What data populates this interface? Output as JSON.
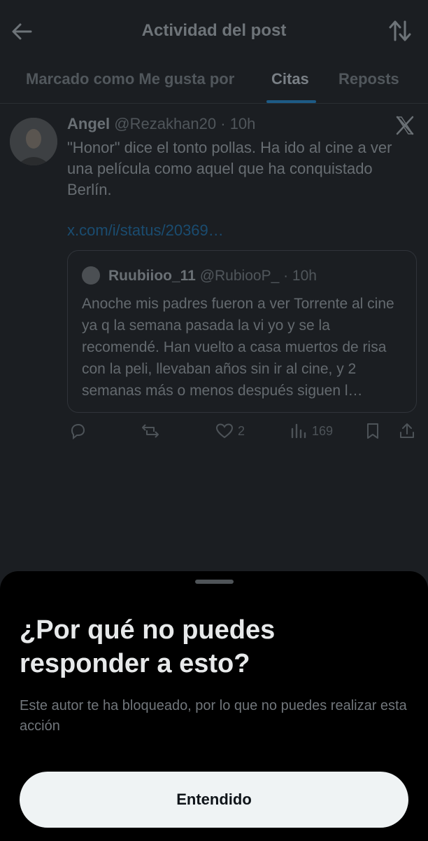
{
  "header": {
    "title": "Actividad del post",
    "back_icon": "arrow-left-icon",
    "sort_icon": "sort-arrows-icon"
  },
  "tabs": [
    {
      "label": "Marcado como Me gusta por",
      "active": false
    },
    {
      "label": "Citas",
      "active": true
    },
    {
      "label": "Reposts",
      "active": false
    }
  ],
  "post": {
    "author": "Angel",
    "handle": "@Rezakhan20",
    "time": "· 10h",
    "text": "\"Honor\" dice el tonto pollas. Ha ido al cine a ver una película como aquel que ha conquistado Berlín.",
    "link": "x.com/i/status/20369…",
    "quote": {
      "author": "Ruubiioo_11",
      "handle": "@RubiooP_",
      "time": "· 10h",
      "text": "Anoche mis padres fueron a ver Torrente al cine ya q la semana pasada la vi yo y se la recomendé. Han vuelto a casa muertos de risa con la peli, llevaban años sin ir al cine, y 2 semanas más o menos después siguen l…"
    },
    "actions": {
      "likes": "2",
      "views": "169"
    }
  },
  "sheet": {
    "title": "¿Por qué no puedes responder a esto?",
    "description": "Este autor te ha bloqueado, por lo que no puedes realizar esta acción",
    "button": "Entendido"
  },
  "colors": {
    "background": "#1b1e22",
    "sheet": "#000000",
    "link": "#1d9bf0",
    "button": "#eff3f4"
  }
}
